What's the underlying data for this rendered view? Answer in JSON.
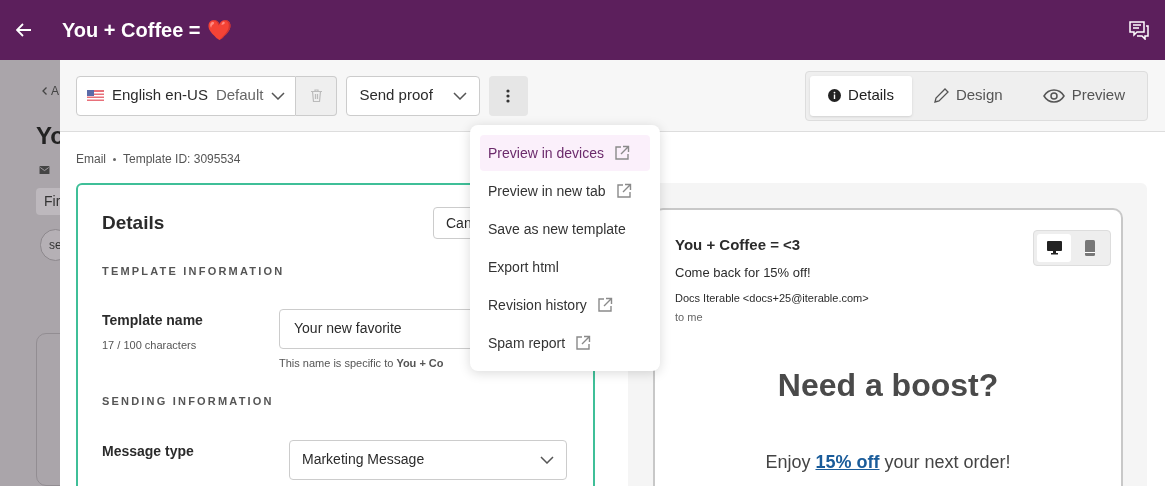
{
  "header": {
    "title": "You + Coffee =",
    "emoji": "❤️"
  },
  "backdrop": {
    "back_link": "A",
    "title": "Yo",
    "tag": "Fir",
    "pill": "se"
  },
  "toolbar": {
    "language": {
      "label": "English en-US",
      "suffix": "Default"
    },
    "send_proof": "Send proof",
    "more_open": true
  },
  "view_tabs": [
    {
      "kind": "info",
      "label": "Details",
      "selected": true
    },
    {
      "kind": "pencil",
      "label": "Design",
      "selected": false
    },
    {
      "kind": "eye",
      "label": "Preview",
      "selected": false
    }
  ],
  "meta": {
    "type": "Email",
    "template_id": "Template ID: 3095534"
  },
  "details": {
    "title": "Details",
    "cancel": "Can",
    "sections": [
      {
        "heading": "TEMPLATE INFORMATION",
        "field": {
          "kind": "text",
          "label": "Template name",
          "sublabel": "17 / 100 characters",
          "value": "Your new favorite",
          "hint": "This name is specific to **You + Co**"
        }
      },
      {
        "heading": "SENDING INFORMATION",
        "field": {
          "kind": "select",
          "label": "Message type",
          "value": "Marketing Message"
        }
      }
    ]
  },
  "menu": [
    {
      "label": "Preview in devices",
      "external": true,
      "selected": true
    },
    {
      "label": "Preview in new tab",
      "external": true,
      "selected": false
    },
    {
      "label": "Save as new template",
      "external": false,
      "selected": false
    },
    {
      "label": "Export html",
      "external": false,
      "selected": false
    },
    {
      "label": "Revision history",
      "external": true,
      "selected": false
    },
    {
      "label": "Spam report",
      "external": true,
      "selected": false
    }
  ],
  "email_preview": {
    "subject": "You + Coffee = <3",
    "preheader": "Come back for 15% off!",
    "from": "Docs Iterable <docs+25@iterable.com>",
    "to": "to me",
    "devices": [
      {
        "kind": "desktop",
        "selected": true
      },
      {
        "kind": "mobile",
        "selected": false
      }
    ],
    "headline": "Need a boost?",
    "body": {
      "before": "Enjoy ",
      "link": "15% off",
      "after": " your next order!"
    }
  }
}
